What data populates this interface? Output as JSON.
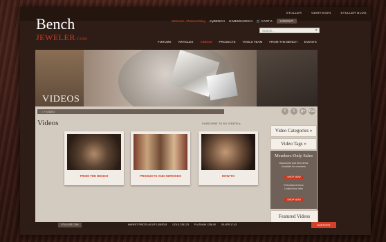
{
  "top_links": [
    "STULLER",
    "GEMVISION",
    "STULLER BLOG"
  ],
  "logo": {
    "line1": "Bench",
    "line2": "JEWELER",
    "suffix": ".COM"
  },
  "user_bar": {
    "welcome": "Welcome, Shelea Farley",
    "my_bench": "myBENCH",
    "messages": "MESSAGES",
    "messages_count": "0",
    "cart": "CART",
    "cart_count": "0",
    "logout": "LOGOUT"
  },
  "search": {
    "placeholder": "Search..."
  },
  "nav": [
    "FORUMS",
    "ARTICLES",
    "VIDEOS",
    "PROJECTS",
    "TOOLS TEAM",
    "FROM THE BENCH",
    "EVENTS"
  ],
  "nav_active": "VIDEOS",
  "hero": {
    "title": "VIDEOS"
  },
  "breadcrumb": "⌂ » VIDEO",
  "social_icons": [
    "f",
    "t",
    "g+",
    "rss"
  ],
  "section": {
    "title": "Videos",
    "subscribe": "SUBSCRIBE TO MY VIDEOS ▸"
  },
  "cards": [
    {
      "label": "FROM THE BENCH"
    },
    {
      "label": "PRODUCTS AND SERVICES"
    },
    {
      "label": "HOW-TO"
    }
  ],
  "sidebar": {
    "categories": "Video Categories »",
    "tags": "Video Tags »",
    "members_title": "Members-Only Sales",
    "members_line1": "Discounted and New Items",
    "members_line2": "Available for members",
    "shop_now_1": "SHOP NOW",
    "refurb_line1": "Refurbished Items",
    "refurb_line2": "Limited time offer",
    "shop_now_2": "SHOP NOW",
    "featured": "Featured Videos"
  },
  "footer": {
    "link": "STULLER.COM",
    "market": "MARKET PRICES AS OF 1/28/2015",
    "gold": "GOLD  1281.23",
    "platinum": "PLATINUM  1236.00",
    "silver": "SILVER  17.43",
    "support": "SUPPORT"
  },
  "colors": {
    "accent": "#d13a1f",
    "dark": "#2e1d16",
    "panel": "#6f6158"
  }
}
